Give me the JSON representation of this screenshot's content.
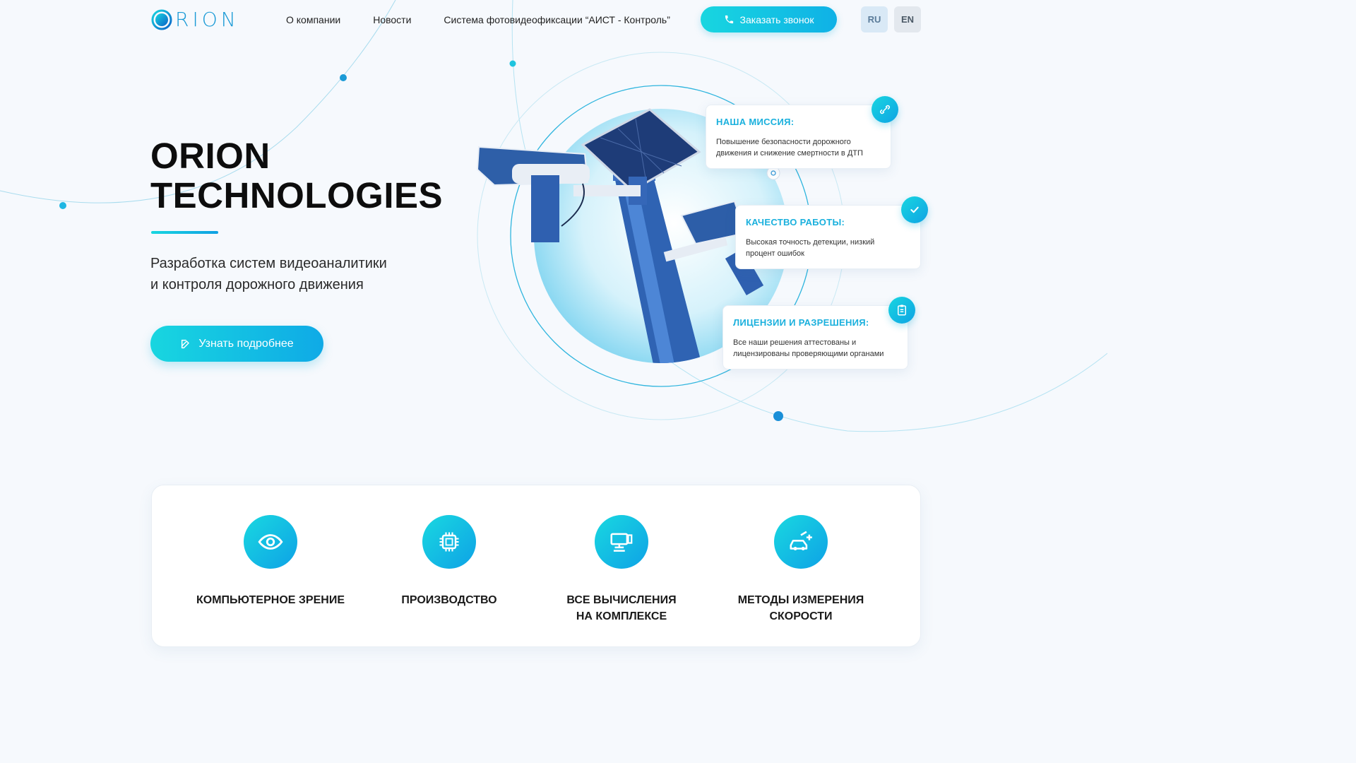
{
  "header": {
    "logo_text": "RION",
    "nav": [
      "О компании",
      "Новости",
      "Система фотовидеофиксации “АИСТ - Контроль”"
    ],
    "call_button": "Заказать звонок",
    "lang_ru": "RU",
    "lang_en": "EN"
  },
  "hero": {
    "title_line1": "ORION",
    "title_line2": "TECHNOLOGIES",
    "subtitle_line1": "Разработка систем видеоаналитики",
    "subtitle_line2": "и контроля дорожного движения",
    "cta": "Узнать подробнее"
  },
  "cards": [
    {
      "title": "НАША МИССИЯ:",
      "text_line1": "Повышение безопасности дорожного",
      "text_line2": "движения и снижение смертности в ДТП",
      "icon": "link-icon"
    },
    {
      "title": "КАЧЕСТВО РАБОТЫ:",
      "text_line1": "Высокая точность детекции, низкий",
      "text_line2": "процент ошибок",
      "icon": "check-icon"
    },
    {
      "title": "ЛИЦЕНЗИИ И РАЗРЕШЕНИЯ:",
      "text_line1": "Все наши решения аттестованы и",
      "text_line2": "лицензированы проверяющими органами",
      "icon": "clipboard-icon"
    }
  ],
  "features": [
    {
      "label_line1": "КОМПЬЮТЕРНОЕ ЗРЕНИЕ",
      "label_line2": "",
      "icon": "eye-icon"
    },
    {
      "label_line1": "ПРОИЗВОДСТВО",
      "label_line2": "",
      "icon": "chip-icon"
    },
    {
      "label_line1": "ВСЕ ВЫЧИСЛЕНИЯ",
      "label_line2": "НА КОМПЛЕКСЕ",
      "icon": "computer-icon"
    },
    {
      "label_line1": "МЕТОДЫ ИЗМЕРЕНИЯ",
      "label_line2": "СКОРОСТИ",
      "icon": "car-speed-icon"
    }
  ],
  "colors": {
    "accent": "#18d6e0",
    "accent_dark": "#0fa3e4",
    "title": "#1ab0dd"
  }
}
